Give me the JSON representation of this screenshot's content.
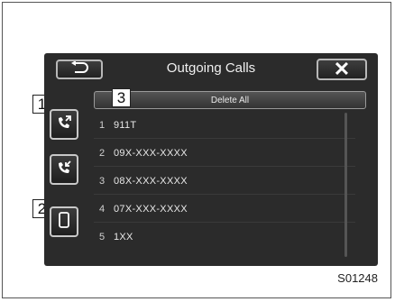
{
  "header": {
    "title": "Outgoing Calls",
    "back_icon": "back-arrow-icon",
    "close_label": "✕"
  },
  "sidebar": {
    "items": [
      {
        "icon": "outgoing-call-icon"
      },
      {
        "icon": "incoming-call-icon"
      },
      {
        "icon": "phone-device-icon"
      }
    ]
  },
  "delete_all": {
    "label": "Delete All"
  },
  "calls": [
    {
      "index": "1",
      "number": "911T"
    },
    {
      "index": "2",
      "number": "09X-XXX-XXXX"
    },
    {
      "index": "3",
      "number": "08X-XXX-XXXX"
    },
    {
      "index": "4",
      "number": "07X-XXX-XXXX"
    },
    {
      "index": "5",
      "number": "1XX"
    }
  ],
  "callouts": [
    "1",
    "2",
    "3"
  ],
  "figure_code": "S01248"
}
